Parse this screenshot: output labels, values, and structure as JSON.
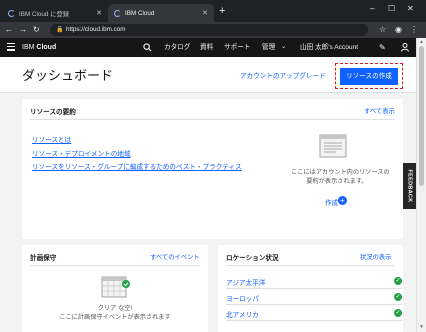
{
  "browser": {
    "tabs": [
      {
        "label": "IBM Cloud に登録",
        "active": false
      },
      {
        "label": "IBM Cloud",
        "active": true
      }
    ],
    "url": "https://cloud.ibm.com"
  },
  "header": {
    "brand_prefix": "IBM",
    "brand_suffix": "Cloud",
    "nav": [
      "カタログ",
      "資料",
      "サポート",
      "管理"
    ],
    "account": "山田 太郎's Account"
  },
  "page": {
    "title": "ダッシュボード",
    "upgrade_link": "アカウントのアップグレード",
    "create_button": "リソースの作成"
  },
  "resource_summary": {
    "title": "リソースの要約",
    "view_all": "すべて表示",
    "links": [
      "リソースとは",
      "リソース・デプロイメントの地域",
      "リソースをリソース・グループに編成するためのベスト・プラクティス"
    ],
    "empty_line1": "ここにはアカウント内のリソースの",
    "empty_line2": "要約が表示されます。",
    "create_link": "作成"
  },
  "maintenance": {
    "title": "計画保守",
    "all_events": "すべてのイベント",
    "empty_line1": "クリア な空!",
    "empty_line2": "ここに計画保守イベントが表示されます"
  },
  "location_status": {
    "title": "ロケーション状況",
    "view_status": "状況の表示",
    "regions": [
      {
        "name": "アジア太平洋",
        "status": "ok"
      },
      {
        "name": "ヨーロッパ",
        "status": "ok"
      },
      {
        "name": "北アメリカ",
        "status": "ok"
      }
    ]
  },
  "feedback_label": "FEEDBACK",
  "colors": {
    "accent": "#0f62fe",
    "header": "#161616",
    "success": "#24a148",
    "highlight": "#da1e28"
  }
}
